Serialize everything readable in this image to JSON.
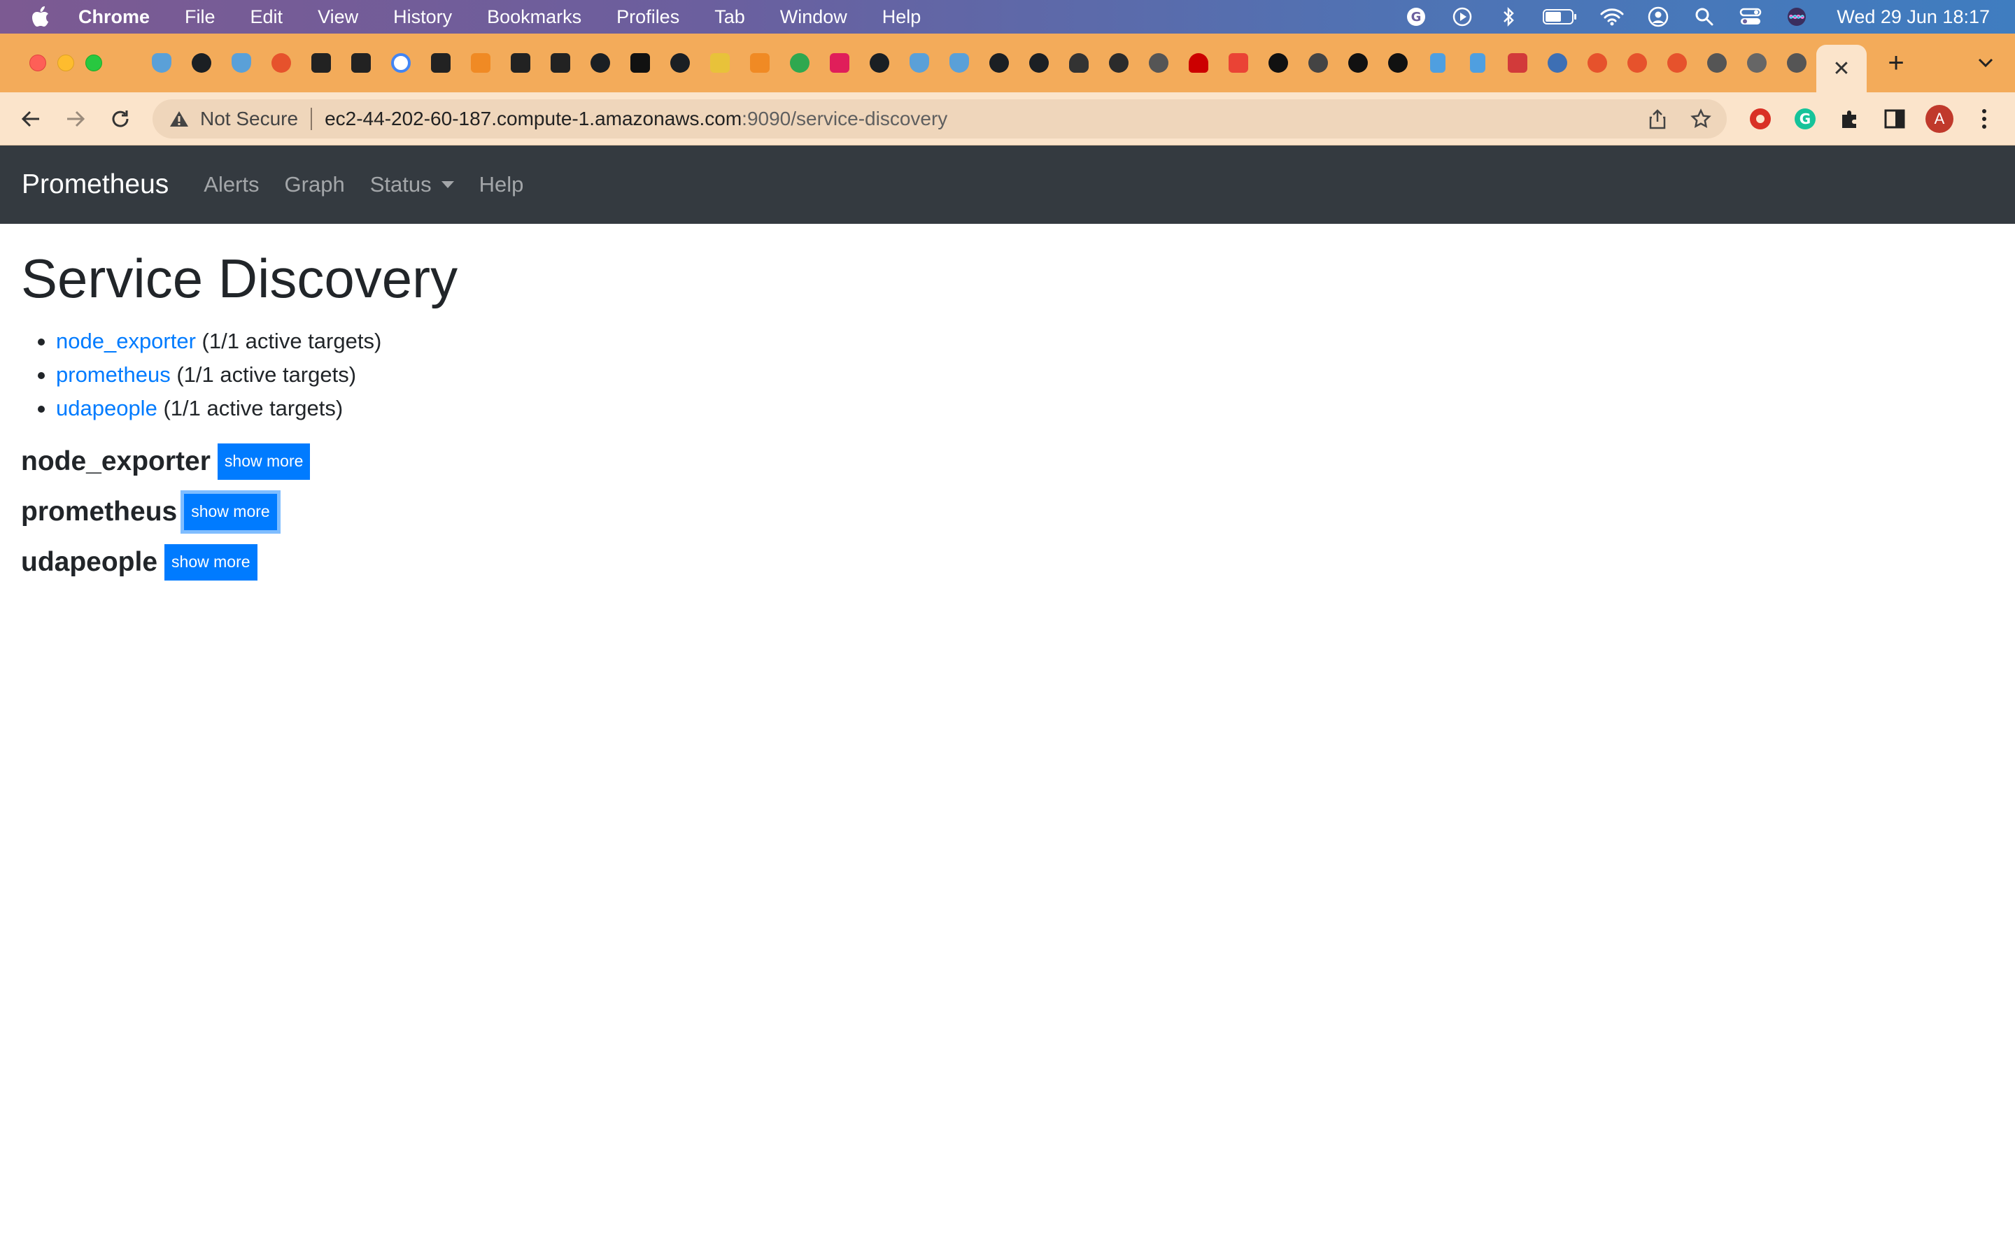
{
  "menubar": {
    "app_name": "Chrome",
    "items": [
      "File",
      "Edit",
      "View",
      "History",
      "Bookmarks",
      "Profiles",
      "Tab",
      "Window",
      "Help"
    ],
    "clock": "Wed 29 Jun  18:17"
  },
  "browser": {
    "active_tab_close": "✕",
    "new_tab": "+",
    "omnibox": {
      "security_label": "Not Secure",
      "url_host": "ec2-44-202-60-187.compute-1.amazonaws.com",
      "url_path": ":9090/service-discovery"
    },
    "profile_initial": "A"
  },
  "navbar": {
    "brand": "Prometheus",
    "links": {
      "alerts": "Alerts",
      "graph": "Graph",
      "status": "Status",
      "help": "Help"
    }
  },
  "page": {
    "title": "Service Discovery",
    "summary": [
      {
        "job": "node_exporter",
        "detail": " (1/1 active targets)"
      },
      {
        "job": "prometheus",
        "detail": " (1/1 active targets)"
      },
      {
        "job": "udapeople",
        "detail": " (1/1 active targets)"
      }
    ],
    "sections": [
      {
        "job": "node_exporter",
        "button": "show more"
      },
      {
        "job": "prometheus",
        "button": "show more"
      },
      {
        "job": "udapeople",
        "button": "show more"
      }
    ]
  }
}
